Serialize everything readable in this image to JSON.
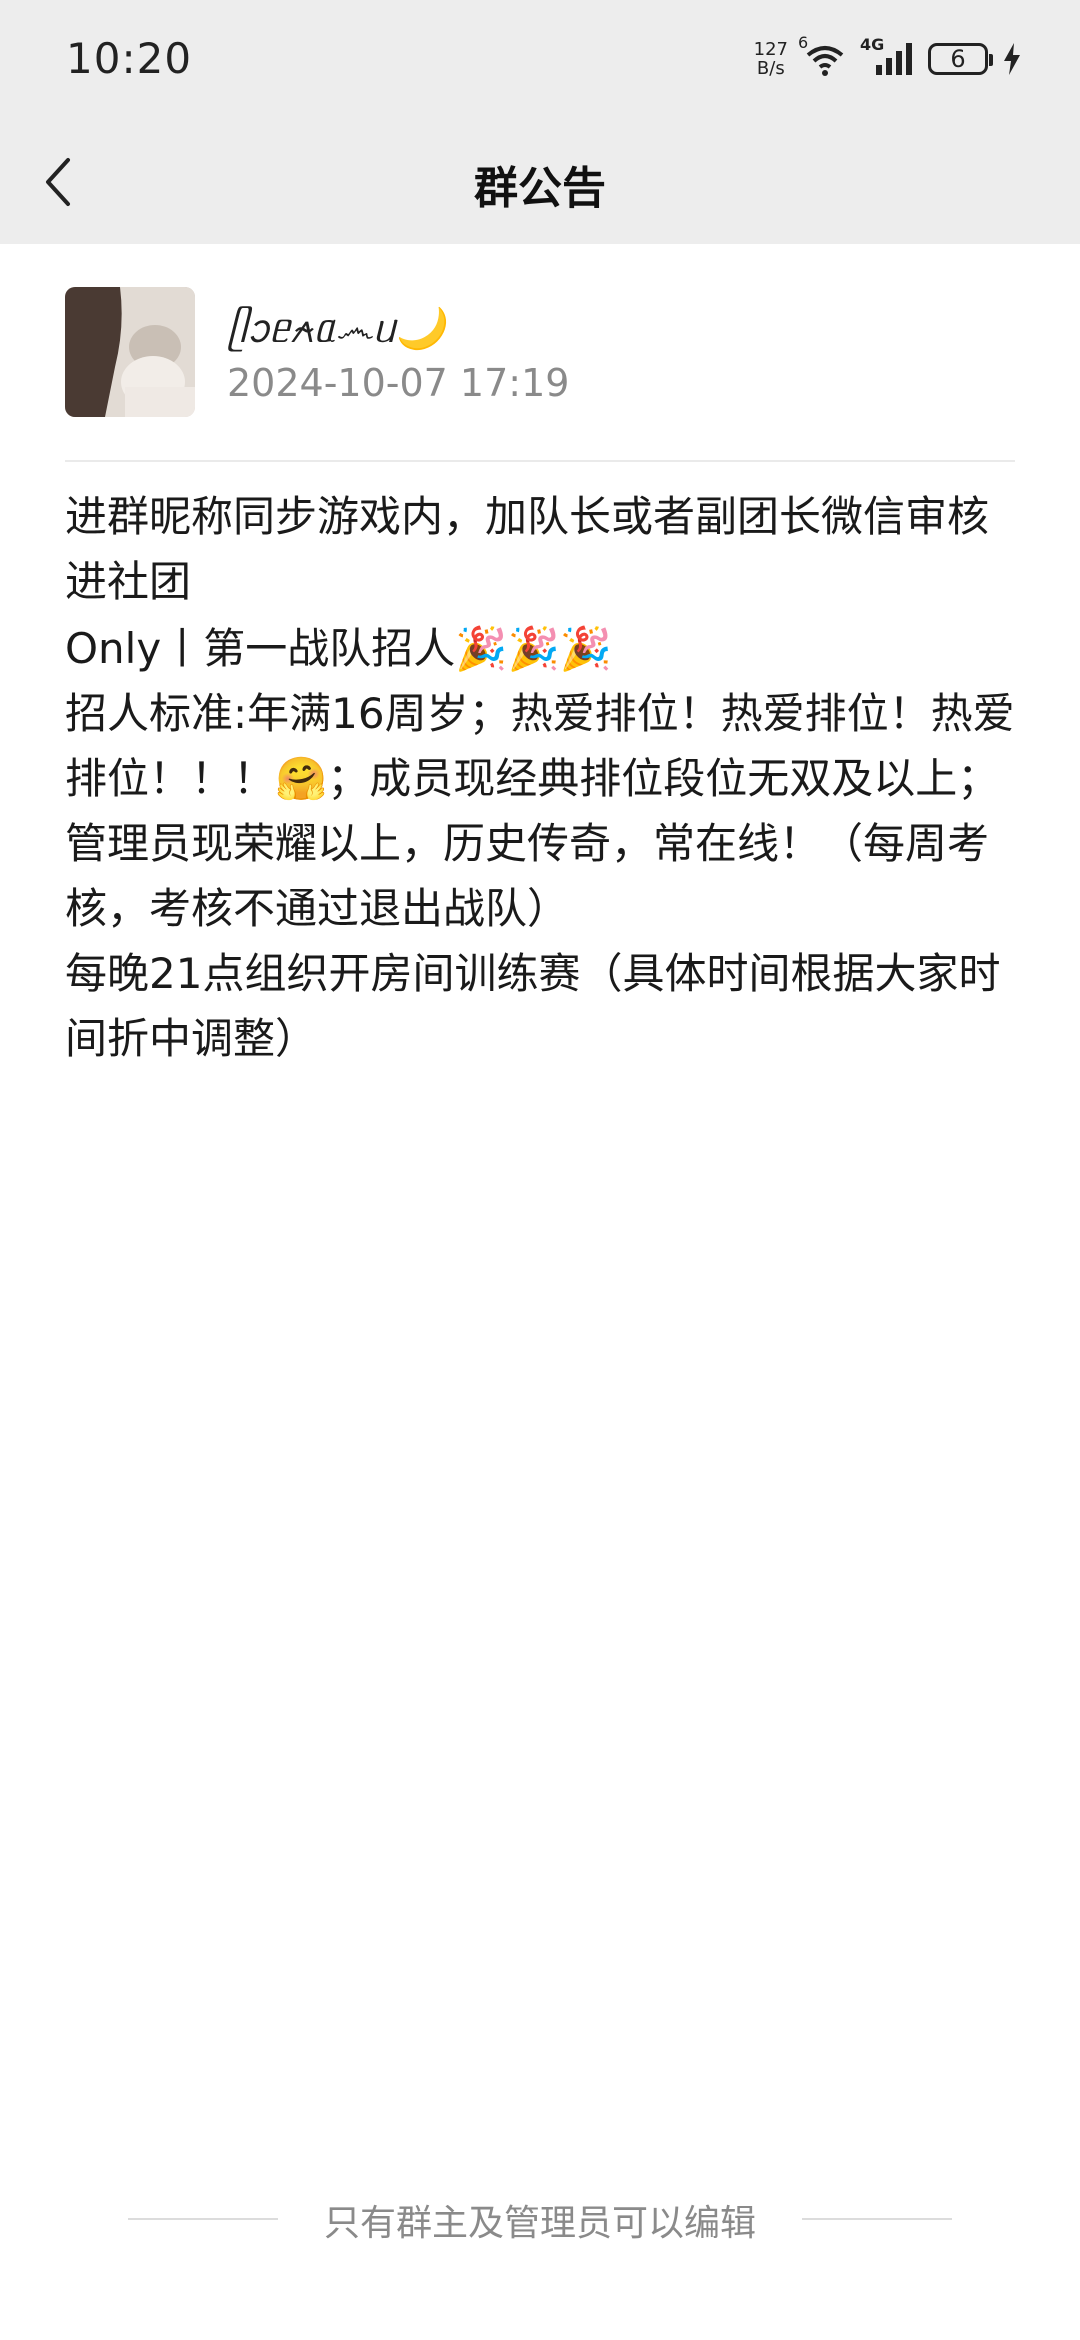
{
  "status_bar": {
    "time": "10:20",
    "net_speed_value": "127",
    "net_speed_unit": "B/s",
    "wifi_label": "6",
    "cell_label": "4G",
    "battery_level": "6"
  },
  "nav": {
    "title": "群公告",
    "back_icon": "chevron-left-icon"
  },
  "author": {
    "name": "ᥫᩣᥱ⍲ᥲ෴ᥙ🌙",
    "time": "2024-10-07 17:19"
  },
  "notice": {
    "lines": [
      "进群昵称同步游戏内，加队长或者副团长微信审核进社团",
      "Only丨第一战队招人🎉🎉🎉",
      "招人标准:年满16周岁；热爱排位！热爱排位！热爱排位！！！🤗；成员现经典排位段位无双及以上；管理员现荣耀以上，历史传奇，常在线！（每周考核，考核不通过退出战队）",
      "每晚21点组织开房间训练赛（具体时间根据大家时间折中调整）"
    ]
  },
  "footer": {
    "text": "只有群主及管理员可以编辑"
  }
}
